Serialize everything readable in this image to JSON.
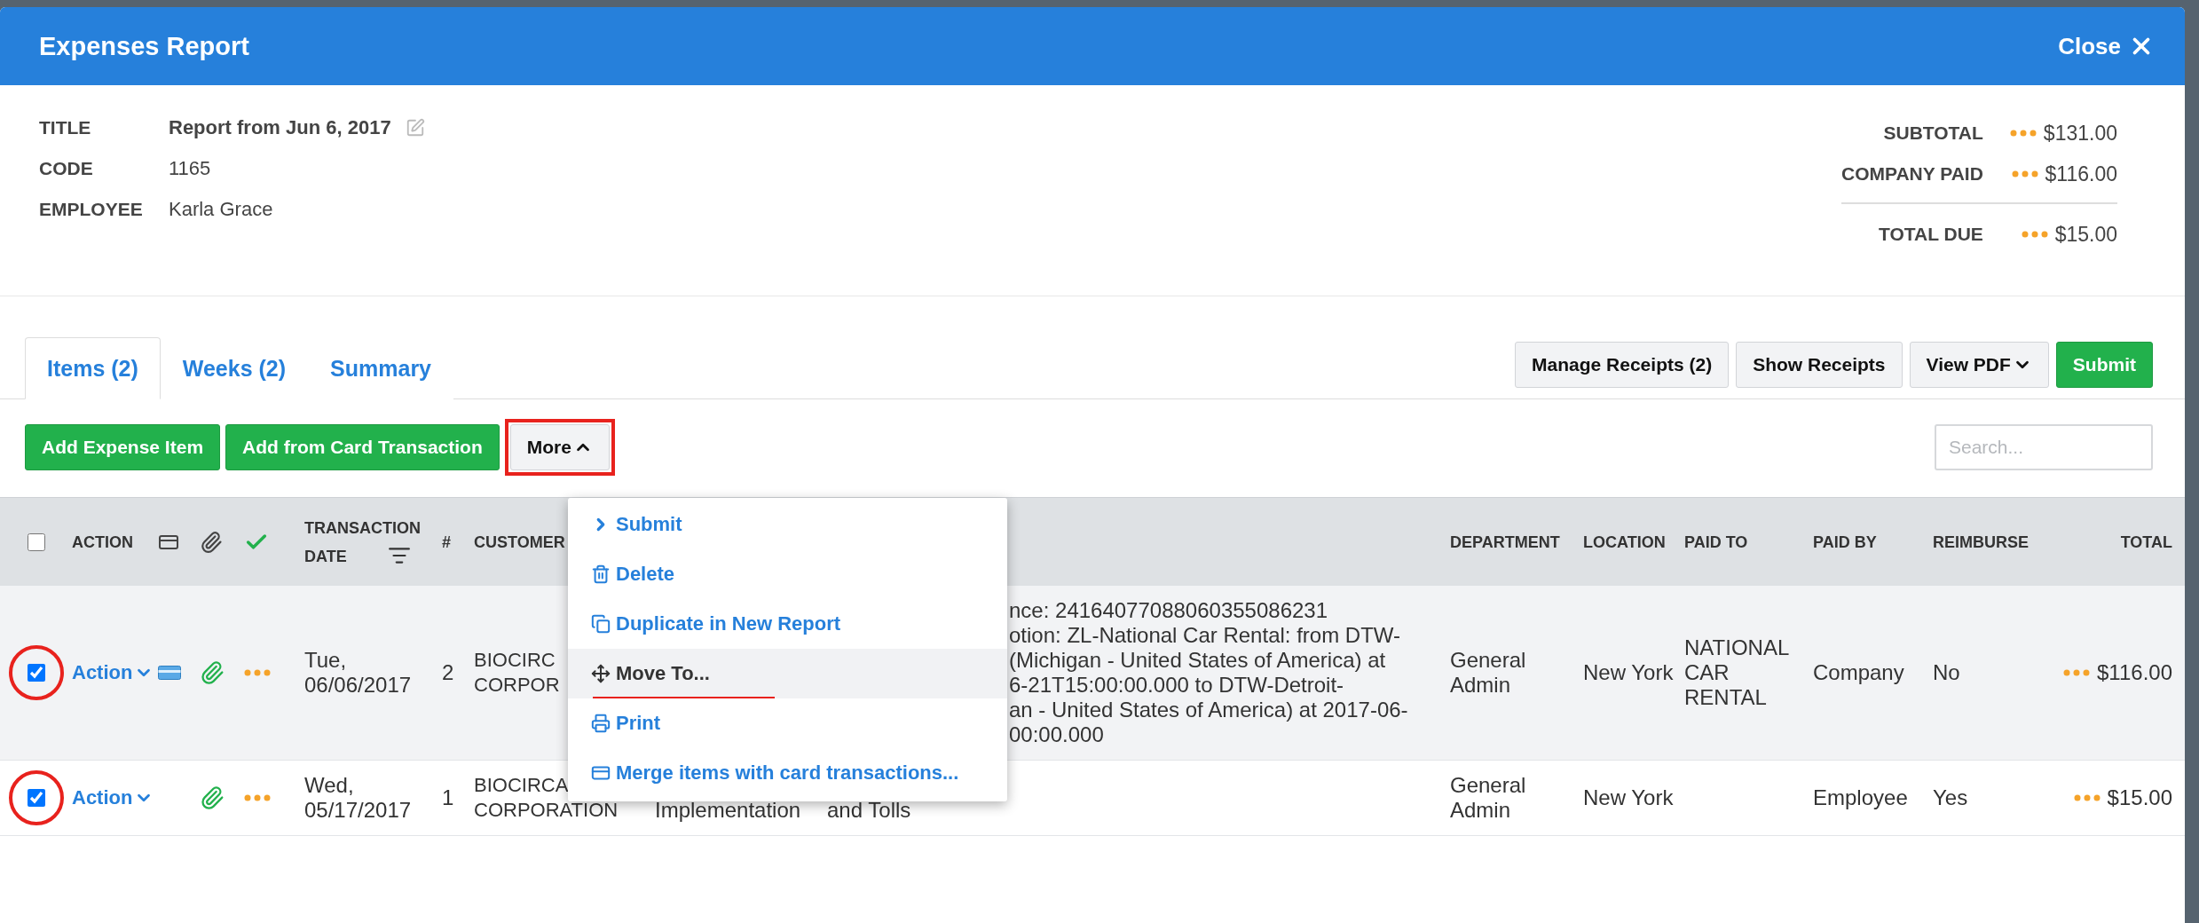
{
  "window": {
    "title": "Expenses Report",
    "close": "Close"
  },
  "details": [
    {
      "label": "TITLE",
      "value": "Report from Jun 6, 2017",
      "editable": true
    },
    {
      "label": "CODE",
      "value": "1165",
      "editable": false
    },
    {
      "label": "EMPLOYEE",
      "value": "Karla Grace",
      "editable": false
    }
  ],
  "totals": [
    {
      "label": "SUBTOTAL",
      "amount": "$131.00",
      "kind": "line"
    },
    {
      "label": "COMPANY PAID",
      "amount": "$116.00",
      "kind": "line"
    },
    {
      "label": "TOTAL DUE",
      "amount": "$15.00",
      "kind": "total"
    }
  ],
  "tabs": [
    {
      "label": "Items (2)",
      "selected": true
    },
    {
      "label": "Weeks (2)",
      "selected": false
    },
    {
      "label": "Summary",
      "selected": false
    }
  ],
  "header_buttons": [
    {
      "label": "Manage Receipts (2)",
      "kind": "default"
    },
    {
      "label": "Show Receipts",
      "kind": "default"
    },
    {
      "label": "View PDF",
      "kind": "dropdown"
    },
    {
      "label": "Submit",
      "kind": "primary"
    }
  ],
  "toolbar": {
    "buttons": [
      {
        "label": "Add Expense Item",
        "kind": "primary"
      },
      {
        "label": "Add from Card Transaction",
        "kind": "primary"
      },
      {
        "label": "More",
        "kind": "menu",
        "expanded": true
      }
    ],
    "search": {
      "placeholder": "Search..."
    }
  },
  "menu": {
    "items": [
      {
        "label": "Submit",
        "highlighted": false
      },
      {
        "label": "Delete",
        "highlighted": false
      },
      {
        "label": "Duplicate in New Report",
        "highlighted": false
      },
      {
        "label": "Move To...",
        "highlighted": true
      },
      {
        "label": "Print",
        "highlighted": false
      },
      {
        "label": "Merge items with card transactions...",
        "highlighted": false
      }
    ]
  },
  "table": {
    "select_all": false,
    "headers": {
      "action": "ACTION",
      "date": "TRANSACTION DATE",
      "number": "#",
      "customer": "CUSTOMER",
      "department": "DEPARTMENT",
      "location": "LOCATION",
      "paid_to": "PAID TO",
      "paid_by": "PAID BY",
      "reimburse": "REIMBURSE",
      "total": "TOTAL"
    },
    "rows": [
      {
        "checked": true,
        "hovered": true,
        "action": "Action",
        "card": true,
        "attachment": true,
        "date": "Tue, 06/06/2017",
        "number": "2",
        "customer": [
          "BIOCIRC",
          "CORPOR"
        ],
        "description": [
          "nce: 24164077088060355086231",
          "otion: ZL-National Car Rental: from DTW-",
          "(Michigan - United States of America) at",
          "6-21T15:00:00.000 to DTW-Detroit-",
          "an - United States of America) at 2017-06-",
          "00:00.000"
        ],
        "department": "General Admin",
        "location": "New York",
        "paid_to": "NATIONAL CAR RENTAL",
        "paid_by": "Company",
        "reimburse": "No",
        "total": "$116.00"
      },
      {
        "checked": true,
        "hovered": false,
        "action": "Action",
        "card": false,
        "attachment": true,
        "date": "Wed, 05/17/2017",
        "number": "1",
        "customer": [
          "BIOCIRCA",
          "CORPORATION"
        ],
        "column_3": "Implementation",
        "description": [
          "and Tolls"
        ],
        "department": "General Admin",
        "location": "New York",
        "paid_by": "Employee",
        "reimburse": "Yes",
        "total": "$15.00"
      }
    ]
  }
}
